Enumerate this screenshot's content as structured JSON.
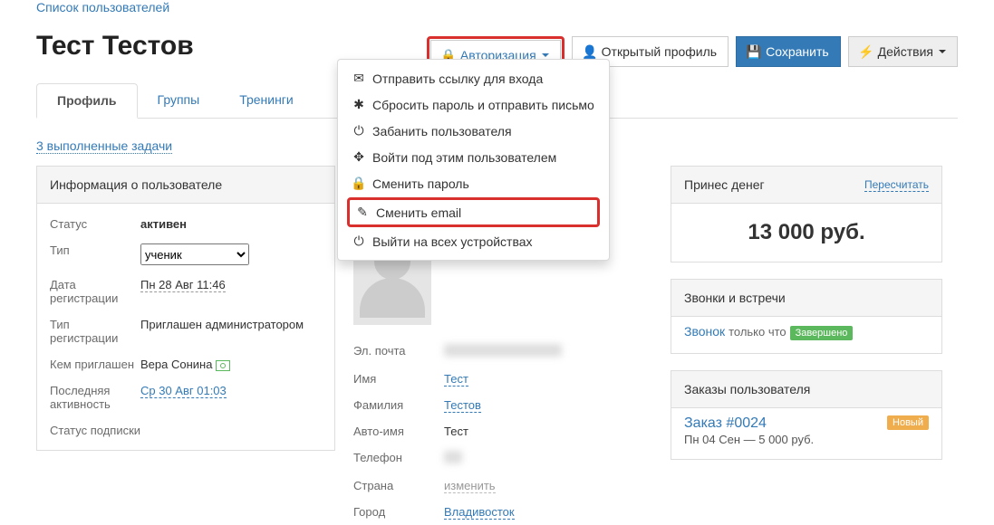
{
  "breadcrumb": "Список пользователей",
  "title": "Тест Тестов",
  "toolbar": {
    "auth": "Авторизация",
    "open": "Открытый профиль",
    "save": "Сохранить",
    "actions": "Действия"
  },
  "tabs": {
    "profile": "Профиль",
    "groups": "Группы",
    "trainings": "Тренинги"
  },
  "subtask": "3 выполненные задачи",
  "authmenu": {
    "send_login": "Отправить ссылку для входа",
    "reset_pass": "Сбросить пароль и отправить письмо",
    "ban": "Забанить пользователя",
    "login_as": "Войти под этим пользователем",
    "change_pass": "Сменить пароль",
    "change_email": "Сменить email",
    "logout_all": "Выйти на всех устройствах"
  },
  "left": {
    "panel": "Информация о пользователе",
    "status_k": "Статус",
    "status_v": "активен",
    "type_k": "Тип",
    "type_v": "ученик",
    "regdate_k": "Дата регистрации",
    "regdate_v": "Пн 28 Авг 11:46",
    "regtype_k": "Тип регистрации",
    "regtype_v": "Приглашен администратором",
    "inviter_k": "Кем приглашен",
    "inviter_v": "Вера Сонина",
    "last_k": "Последняя активность",
    "last_v": "Ср 30 Авг 01:03",
    "substatus_k": "Статус подписки"
  },
  "mid": {
    "name": "Тест Тестов",
    "email_k": "Эл. почта",
    "fname_k": "Имя",
    "fname_v": "Тест",
    "lname_k": "Фамилия",
    "lname_v": "Тестов",
    "autoname_k": "Авто-имя",
    "autoname_v": "Тест",
    "phone_k": "Телефон",
    "country_k": "Страна",
    "country_v": "изменить",
    "city_k": "Город",
    "city_v": "Владивосток"
  },
  "right": {
    "money_panel": "Принес денег",
    "recalc": "Пересчитать",
    "money": "13 000 руб.",
    "calls_panel": "Звонки и встречи",
    "call_link": "Звонок",
    "call_time": "только что",
    "call_status": "Завершено",
    "orders_panel": "Заказы пользователя",
    "order_link": "Заказ #0024",
    "order_date": "Пн 04 Сен — 5 000 руб.",
    "order_badge": "Новый"
  }
}
